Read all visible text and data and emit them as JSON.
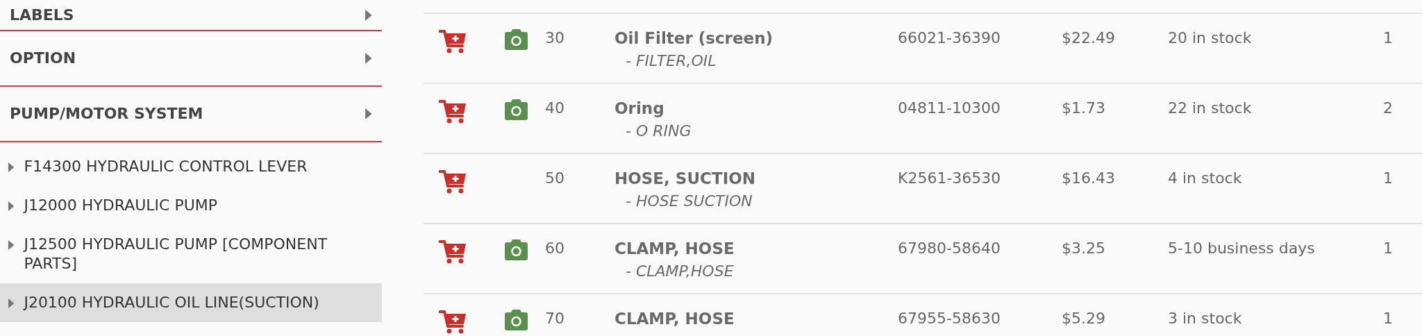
{
  "sidebar": {
    "categories": [
      {
        "label": "LABELS"
      },
      {
        "label": "OPTION"
      },
      {
        "label": "PUMP/MOTOR SYSTEM"
      }
    ],
    "items": [
      {
        "label": "F14300 HYDRAULIC CONTROL LEVER",
        "selected": false
      },
      {
        "label": "J12000 HYDRAULIC PUMP",
        "selected": false
      },
      {
        "label": "J12500 HYDRAULIC PUMP [COMPONENT PARTS]",
        "selected": false
      },
      {
        "label": "J20100 HYDRAULIC OIL LINE(SUCTION)",
        "selected": true
      }
    ]
  },
  "parts": {
    "rows": [
      {
        "has_photo": true,
        "ref": "30",
        "name": "Oil Filter (screen)",
        "description": "- FILTER,OIL",
        "part_number": "66021-36390",
        "price": "$22.49",
        "availability": "20 in stock",
        "qty": "1"
      },
      {
        "has_photo": true,
        "ref": "40",
        "name": "Oring",
        "description": "- O RING",
        "part_number": "04811-10300",
        "price": "$1.73",
        "availability": "22 in stock",
        "qty": "2"
      },
      {
        "has_photo": false,
        "ref": "50",
        "name": "HOSE, SUCTION",
        "description": "- HOSE SUCTION",
        "part_number": "K2561-36530",
        "price": "$16.43",
        "availability": "4 in stock",
        "qty": "1"
      },
      {
        "has_photo": true,
        "ref": "60",
        "name": "CLAMP, HOSE",
        "description": "- CLAMP,HOSE",
        "part_number": "67980-58640",
        "price": "$3.25",
        "availability": "5-10 business days",
        "qty": "1"
      },
      {
        "has_photo": true,
        "ref": "70",
        "name": "CLAMP, HOSE",
        "part_number": "67955-58630",
        "price": "$5.29",
        "availability": "3 in stock",
        "qty": "1"
      }
    ]
  }
}
